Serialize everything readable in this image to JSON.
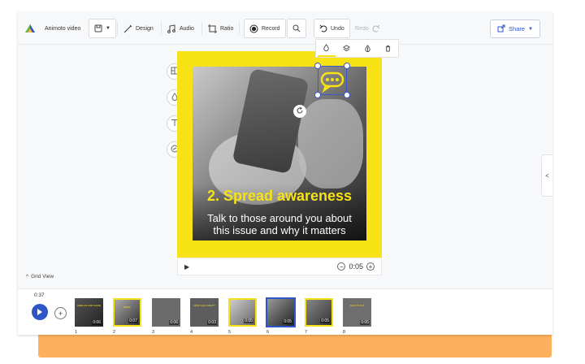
{
  "toolbar": {
    "project_name": "Animoto video",
    "design_label": "Design",
    "audio_label": "Audio",
    "ratio_label": "Ratio",
    "record_label": "Record",
    "undo_label": "Undo",
    "redo_label": "Redo",
    "share_label": "Share"
  },
  "canvas": {
    "headline": "2. Spread awareness",
    "subtext_line1": "Talk to those around you about",
    "subtext_line2": "this issue and why it matters",
    "accent_color": "#f6e215"
  },
  "player": {
    "time": "0:05"
  },
  "grid_view_label": "Grid View",
  "timeline": {
    "total_duration": "0:37",
    "scenes": [
      {
        "number": "1",
        "duration": "0:06",
        "text": "HIRE US FOR SOME"
      },
      {
        "number": "2",
        "duration": "0:07",
        "text": "WHAT"
      },
      {
        "number": "3",
        "duration": "0:06",
        "text": ""
      },
      {
        "number": "4",
        "duration": "0:03",
        "text": "HOW CAN I HELP?"
      },
      {
        "number": "5",
        "duration": "0:05",
        "text": ""
      },
      {
        "number": "6",
        "duration": "0:05",
        "text": ""
      },
      {
        "number": "7",
        "duration": "0:05",
        "text": ""
      },
      {
        "number": "8",
        "duration": "0:05",
        "text": "TALK IT OUT"
      }
    ]
  },
  "icons": {
    "logo": "animoto-logo-icon",
    "save": "save-icon",
    "design": "pen-icon",
    "audio": "music-icon",
    "ratio": "crop-icon",
    "record": "record-icon",
    "search": "search-icon",
    "undo": "undo-icon",
    "redo": "redo-icon",
    "share": "share-icon"
  }
}
